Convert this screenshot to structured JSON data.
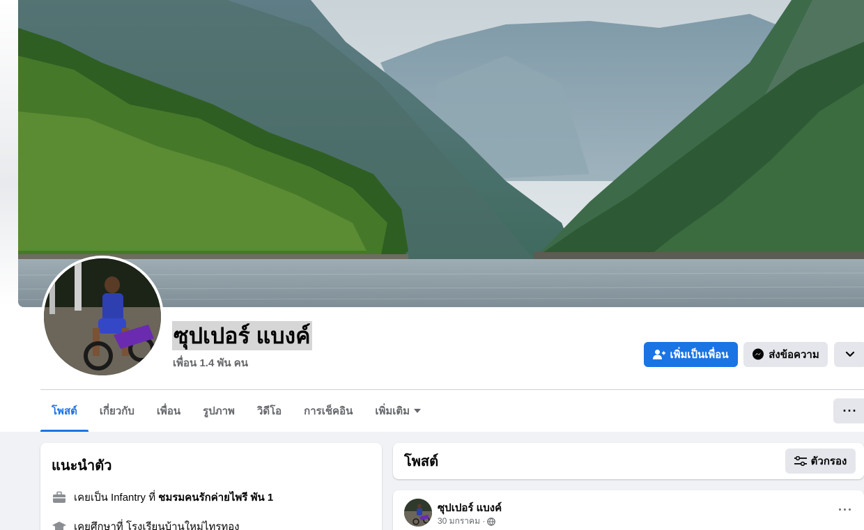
{
  "profile": {
    "name": "ซุปเปอร์ แบงค์",
    "friend_count": "เพื่อน 1.4 พัน คน"
  },
  "actions": {
    "add_friend": "เพิ่มเป็นเพื่อน",
    "message": "ส่งข้อความ"
  },
  "tabs": [
    {
      "label": "โพสต์"
    },
    {
      "label": "เกี่ยวกับ"
    },
    {
      "label": "เพื่อน"
    },
    {
      "label": "รูปภาพ"
    },
    {
      "label": "วิดีโอ"
    },
    {
      "label": "การเช็คอิน"
    },
    {
      "label": "เพิ่มเติม"
    }
  ],
  "intro": {
    "title": "แนะนำตัว",
    "work": {
      "prefix": "เคยเป็น Infantry ที่",
      "place": "ชมรมคนรักค่ายไพรี พัน 1"
    },
    "education": {
      "prefix": "เคยศึกษาที่",
      "place": "โรงเรียนบ้านใหม่ไทรทอง"
    }
  },
  "posts": {
    "title": "โพสต์",
    "filter_label": "ตัวกรอง"
  },
  "post": {
    "author": "ซุปเปอร์ แบงค์",
    "date": "30 มกราคม ·"
  },
  "colors": {
    "primary": "#1b74e4",
    "secondary_button": "#e4e6eb",
    "muted_text": "#65676b",
    "page_bg": "#f0f2f5"
  }
}
